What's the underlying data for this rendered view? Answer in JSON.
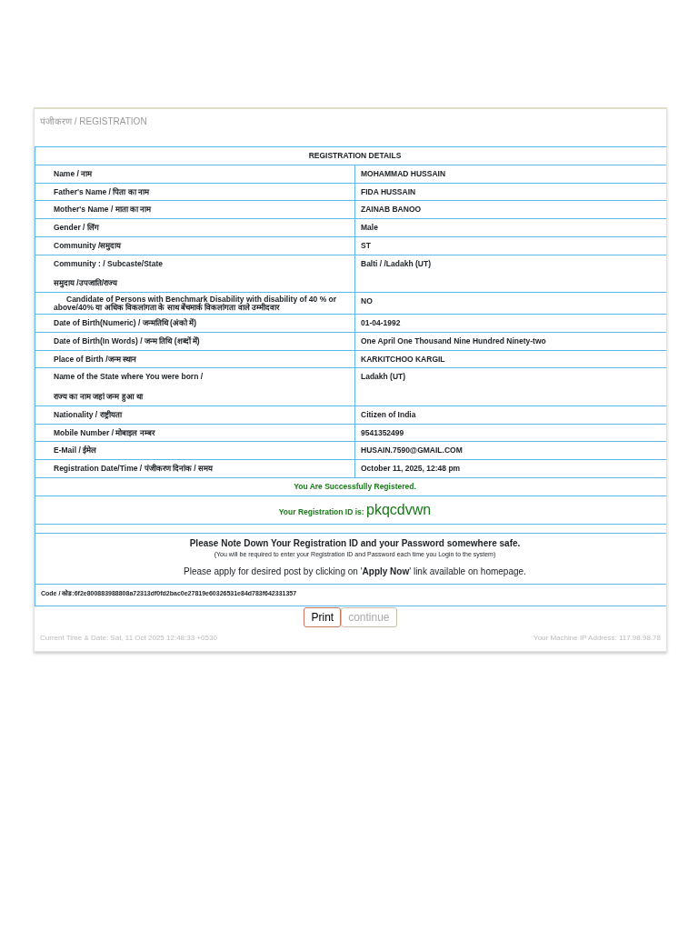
{
  "breadcrumb": "पंजीकरण / REGISTRATION",
  "table": {
    "title": "REGISTRATION DETAILS",
    "rows": [
      {
        "label": [
          "Name / नाम"
        ],
        "value": "MOHAMMAD HUSSAIN"
      },
      {
        "label": [
          "Father's Name / पिता का नाम"
        ],
        "value": "FIDA HUSSAIN"
      },
      {
        "label": [
          "Mother's Name / माता का नाम"
        ],
        "value": "ZAINAB BANOO"
      },
      {
        "label": [
          "Gender / लिंग"
        ],
        "value": "Male"
      },
      {
        "label": [
          "Community /समुदाय"
        ],
        "value": "ST"
      },
      {
        "label": [
          "Community :  / Subcaste/State",
          "समुदाय /उपजाति/राज्य"
        ],
        "value": "Balti / /Ladakh (UT)"
      },
      {
        "label": [
          "Candidate of Persons with Benchmark Disability with disability of 40 % or above/40% या अधिक विकलांगता के साथ बेंचमार्क विकलांगता वाले उम्मीदवार"
        ],
        "value": "NO"
      },
      {
        "label": [
          "Date of Birth(Numeric) / जन्मतिथि (अंको में)"
        ],
        "value": "01-04-1992"
      },
      {
        "label": [
          "Date of Birth(In Words) / जन्म तिथि (शब्दों में)"
        ],
        "value": "One April One Thousand Nine Hundred Ninety-two"
      },
      {
        "label": [
          "Place of Birth /जन्म स्थान"
        ],
        "value": "KARKITCHOO KARGIL"
      },
      {
        "label": [
          "Name of the State where You were born /",
          "राज्य का नाम जहां जन्म हुआ था"
        ],
        "value": "Ladakh (UT)"
      },
      {
        "label": [
          "Nationality / राष्ट्रीयता"
        ],
        "value": "Citizen of India"
      },
      {
        "label": [
          "Mobile Number / मोबाइल नम्बर"
        ],
        "value": "9541352499"
      },
      {
        "label": [
          "E-Mail / ईमेल"
        ],
        "value": "HUSAIN.7590@GMAIL.COM"
      },
      {
        "label": [
          "Registration Date/Time / पंजीकरण दिनांक / समय"
        ],
        "value": "October 11, 2025, 12:48 pm"
      }
    ],
    "success": "You Are Successfully Registered.",
    "id_label": "Your Registration ID is:",
    "id_value": "pkqcdvwn",
    "note_title": "Please Note Down Your Registration ID and your Password somewhere safe.",
    "note_sub": "(You will be required to enter your Registration ID and Password each time you Login to the system)",
    "apply_note": "Please apply for desired post by clicking on '**Apply Now**' link available on homepage.",
    "code": "Code / कोड:6f2e800883988808a72313df0fd2bac0e27819e60326531e84d783f642331357"
  },
  "buttons": [
    {
      "label": "Print",
      "disabled": false
    },
    {
      "label": "continue",
      "disabled": true
    }
  ],
  "footer": {
    "time": "Current Time & Date: Sat, 11 Oct 2025 12:48:33 +0530",
    "ip": "Your Machine IP Address: 117.98.98.78"
  }
}
